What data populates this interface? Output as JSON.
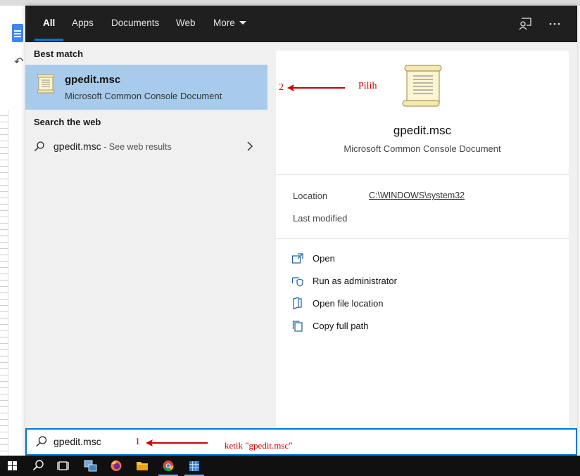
{
  "tabs": [
    {
      "label": "All",
      "active": true
    },
    {
      "label": "Apps"
    },
    {
      "label": "Documents"
    },
    {
      "label": "Web"
    },
    {
      "label": "More"
    }
  ],
  "nav_icons": [
    "feedback-icon",
    "more-options-icon"
  ],
  "best_match": {
    "heading": "Best match",
    "name": "gpedit.msc",
    "type": "Microsoft Common Console Document",
    "icon": "scroll-document-icon"
  },
  "web_search": {
    "heading": "Search the web",
    "query": "gpedit.msc",
    "suffix": " - See web results"
  },
  "preview": {
    "name": "gpedit.msc",
    "type": "Microsoft Common Console Document",
    "location_label": "Location",
    "location_value": "C:\\WINDOWS\\system32",
    "modified_label": "Last modified"
  },
  "actions": [
    {
      "label": "Open",
      "icon": "open-icon"
    },
    {
      "label": "Run as administrator",
      "icon": "shield-admin-icon"
    },
    {
      "label": "Open file location",
      "icon": "folder-location-icon"
    },
    {
      "label": "Copy full path",
      "icon": "copy-icon"
    }
  ],
  "search": {
    "value": "gpedit.msc"
  },
  "annotations": {
    "step1_number": "1",
    "step1_text": "ketik \"gpedit.msc\"",
    "step2_number": "2",
    "step2_text": "Pilih",
    "color": "#d10000"
  },
  "colors": {
    "accent": "#0078d7",
    "selected": "#a9cbeb",
    "nav_bg": "#1f1f1f"
  },
  "taskbar": [
    "windows-start-icon",
    "search-icon",
    "task-view-icon",
    "network-app-icon",
    "firefox-icon",
    "file-explorer-icon",
    "chrome-icon",
    "app-grid-icon"
  ]
}
